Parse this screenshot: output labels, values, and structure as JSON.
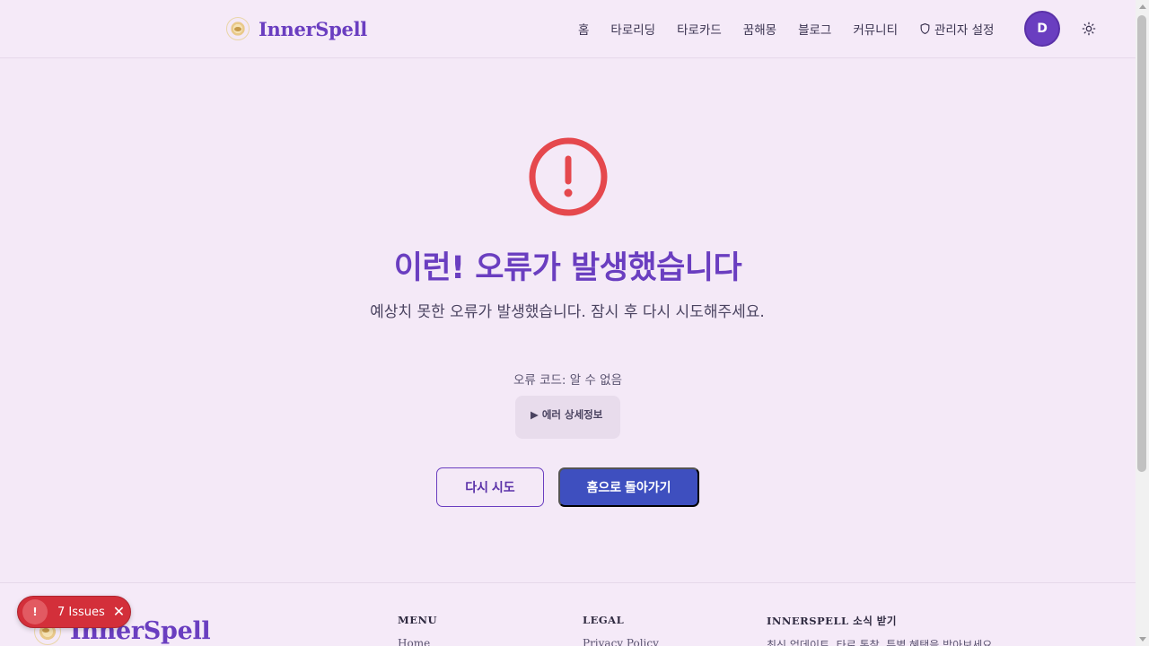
{
  "header": {
    "logo_text": "InnerSpell",
    "nav": [
      {
        "label": "홈"
      },
      {
        "label": "타로리딩"
      },
      {
        "label": "타로카드"
      },
      {
        "label": "꿈해몽"
      },
      {
        "label": "블로그"
      },
      {
        "label": "커뮤니티"
      },
      {
        "label": "관리자 설정"
      }
    ],
    "avatar_initial": "D",
    "theme_icon": "sun-icon"
  },
  "error": {
    "icon": "alert-circle-icon",
    "title": "이런! 오류가 발생했습니다",
    "description": "예상치 못한 오류가 발생했습니다. 잠시 후 다시 시도해주세요.",
    "code": "오류 코드: 알 수 없음",
    "details_label": "▶ 에러 상세정보",
    "retry_label": "다시 시도",
    "home_label": "홈으로 돌아가기"
  },
  "footer": {
    "logo_text": "InnerSpell",
    "columns": [
      {
        "title": "MENU",
        "first_item": "Home"
      },
      {
        "title": "LEGAL",
        "first_item": "Privacy Policy"
      },
      {
        "title": "INNERSPELL 소식 받기",
        "first_item": "최신 업데이트, 타로 통찰, 특별 혜택을 받아보세요"
      }
    ]
  },
  "issues_badge": {
    "icon": "!",
    "label": "7 Issues",
    "close": "✕"
  },
  "colors": {
    "brand": "#6a3ec0",
    "primary_button": "#3e4fbf",
    "error": "#e5484d",
    "background": "#f4e9f7"
  }
}
